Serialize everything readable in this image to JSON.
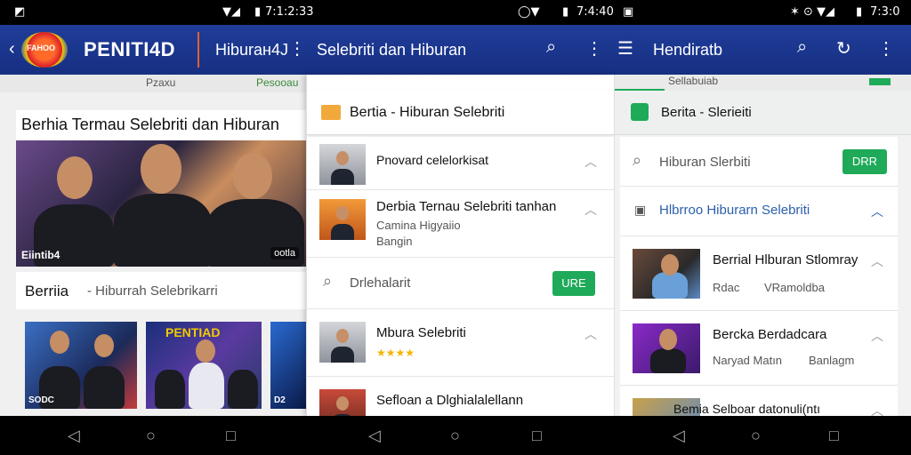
{
  "status": {
    "time1": "7:1:2:33",
    "time2": "7:4:40",
    "time3": "7:3:0"
  },
  "appbar": {
    "logo_text": "FAHOO",
    "brand": "PENITI4D",
    "section": "Hiburaн4J",
    "title_mid": "Selebriti dan Hiburan",
    "title_right": "Hendiratb"
  },
  "panel1": {
    "tab_a": "Pzaxu",
    "tab_b": "Pesooau",
    "headline": "Berhia Termau Selebriti dan Hiburan",
    "hero_tag": "Eiintib4",
    "hero_badge": "ootla",
    "section_title": "Berriia",
    "section_sub": "- Hiburrah Selebrikarri",
    "thumb1_caption": "SODC",
    "thumb2_caption": "PENTIAD",
    "thumb3_caption": "D2"
  },
  "panel2": {
    "header_title": "Bertia - Hiburan Selebriti",
    "row1_title": "Pnovard celelorkisat",
    "row2_title": "Derbia Ternau Selebriti tanhan",
    "row2_sub1": "Camina Higyaiio",
    "row2_sub2": "Bangin",
    "search_placeholder": "Drlehalarit",
    "search_btn": "URE",
    "row3_title": "Mbura Selebriti",
    "row3_stars": "★★★★",
    "row4_title": "Sefloan a Dlghialalellann"
  },
  "panel3": {
    "tab_a": "Sellabuiab",
    "header_title": "Berita - Slerieiti",
    "search_text": "Hiburan Slerbiti",
    "search_btn": "DRR",
    "section_title": "Hlbrroo Hiburarn Selebriti",
    "card1_title": "Berrial Hlburan Stlomray",
    "card1_sub": "Rdac",
    "card1_sub2": "VRamoldba",
    "card2_title": "Bercka Berdadcara",
    "card2_sub": "Naryad Matın",
    "card2_sub2": "Banlagm",
    "card3_title": "Bemia Selboar datonuli(ntı"
  },
  "icons": {
    "search": "search-icon",
    "more": "more-vert-icon",
    "back": "back-arrow-icon",
    "refresh": "refresh-icon",
    "menu": "menu-icon"
  },
  "colors": {
    "appbar": "#1f3d99",
    "accent_green": "#1faa59",
    "link_blue": "#2b5fad"
  }
}
